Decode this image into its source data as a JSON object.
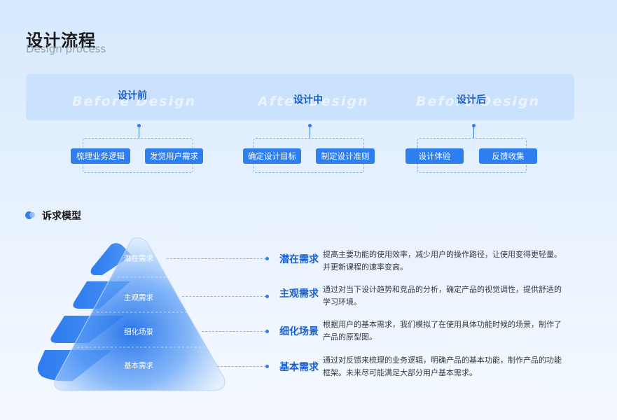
{
  "header": {
    "title_cn": "设计流程",
    "title_en": "Design process"
  },
  "process": {
    "ghost_texts": [
      "Before Design",
      "After Design",
      "Before Design"
    ],
    "stages": [
      {
        "title": "设计前",
        "items": [
          "梳理业务逻辑",
          "发觉用户需求"
        ]
      },
      {
        "title": "设计中",
        "items": [
          "确定设计目标",
          "制定设计准则"
        ]
      },
      {
        "title": "设计后",
        "items": [
          "设计体验",
          "反馈收集"
        ]
      }
    ]
  },
  "appeal": {
    "title": "诉求模型",
    "layers": [
      "潜在需求",
      "主观需求",
      "细化场景",
      "基本需求"
    ],
    "needs": [
      {
        "title": "潜在需求",
        "desc": "提高主要功能的使用效率，减少用户的操作路径，让使用变得更轻量。并更新课程的速率变高。"
      },
      {
        "title": "主观需求",
        "desc": "通过对当下设计趋势和竞品的分析，确定产品的视觉调性，提供舒适的学习环境。"
      },
      {
        "title": "细化场景",
        "desc": "根据用户的基本需求，我们模拟了在使用具体功能时候的场景，制作了产品的原型图。"
      },
      {
        "title": "基本需求",
        "desc": "通过对反馈来梳理的业务逻辑，明确产品的基本功能，制作产品的功能框架。未来尽可能满足大部分用户基本需求。"
      }
    ]
  },
  "colors": {
    "accent": "#2f7ef0",
    "accent_dark": "#1a5fd0"
  }
}
